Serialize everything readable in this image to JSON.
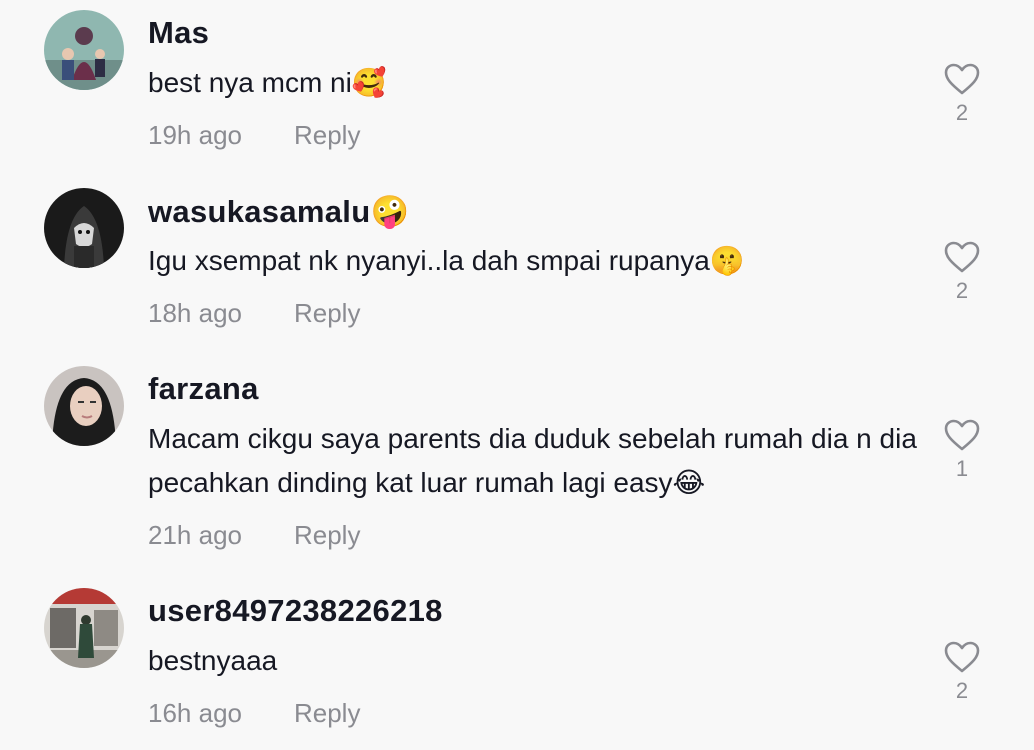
{
  "comments": [
    {
      "username": "Mas",
      "text": "best nya mcm ni🥰",
      "time": "19h ago",
      "reply_label": "Reply",
      "likes": "2",
      "avatar_icon": "family-photo-avatar"
    },
    {
      "username": "wasukasamalu🤪",
      "text": "Igu xsempat nk nyanyi..la dah smpai rupanya🤫",
      "time": "18h ago",
      "reply_label": "Reply",
      "likes": "2",
      "avatar_icon": "dark-anime-avatar"
    },
    {
      "username": "farzana",
      "text": "Macam cikgu saya parents dia duduk sebelah rumah dia n dia pecahkan dinding kat luar rumah lagi easy😂",
      "time": "21h ago",
      "reply_label": "Reply",
      "likes": "1",
      "avatar_icon": "hijab-portrait-avatar"
    },
    {
      "username": "user8497238226218",
      "text": "bestnyaaa",
      "time": "16h ago",
      "reply_label": "Reply",
      "likes": "2",
      "avatar_icon": "street-photo-avatar"
    }
  ],
  "colors": {
    "background": "#f8f8f8",
    "username": "#161823",
    "meta": "#8a8b91"
  }
}
